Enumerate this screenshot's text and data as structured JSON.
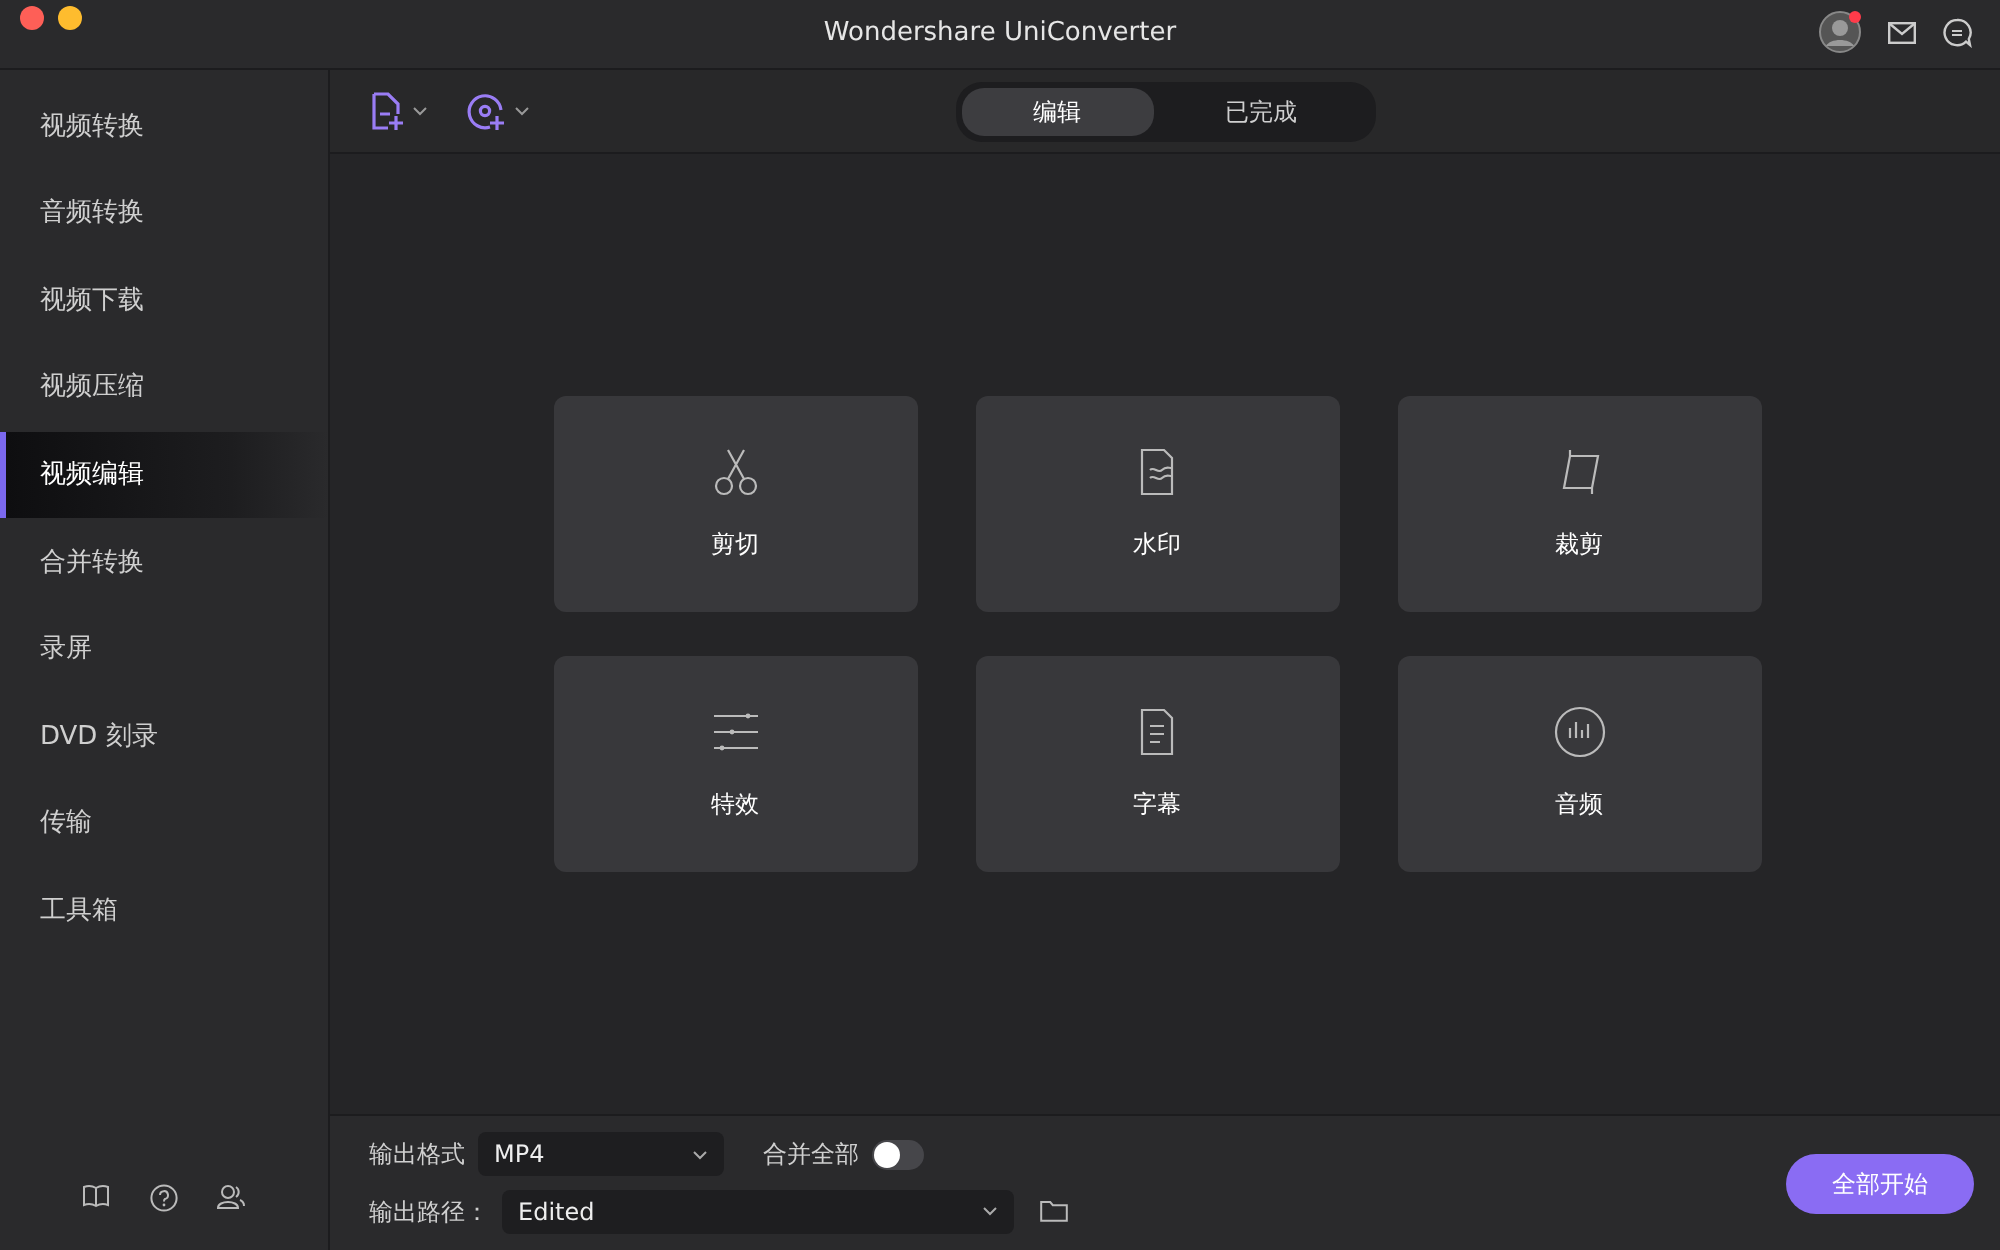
{
  "window": {
    "title": "Wondershare UniConverter"
  },
  "sidebar": {
    "items": [
      {
        "label": "视频转换",
        "selected": false
      },
      {
        "label": "音频转换",
        "selected": false
      },
      {
        "label": "视频下载",
        "selected": false
      },
      {
        "label": "视频压缩",
        "selected": false
      },
      {
        "label": "视频编辑",
        "selected": true
      },
      {
        "label": "合并转换",
        "selected": false
      },
      {
        "label": "录屏",
        "selected": false
      },
      {
        "label": "DVD 刻录",
        "selected": false
      },
      {
        "label": "传输",
        "selected": false
      },
      {
        "label": "工具箱",
        "selected": false
      }
    ]
  },
  "tabs": [
    {
      "label": "编辑",
      "selected": true
    },
    {
      "label": "已完成",
      "selected": false
    }
  ],
  "tools": [
    {
      "label": "剪切",
      "kind": "trim"
    },
    {
      "label": "水印",
      "kind": "watermark"
    },
    {
      "label": "裁剪",
      "kind": "crop"
    },
    {
      "label": "特效",
      "kind": "effects"
    },
    {
      "label": "字幕",
      "kind": "subtitle"
    },
    {
      "label": "音频",
      "kind": "audio"
    }
  ],
  "bottom_bar": {
    "format_label": "输出格式",
    "format_value": "MP4",
    "merge_label": "合并全部",
    "merge_on": false,
    "path_label": "输出路径：",
    "path_value": "Edited",
    "start_button": "全部开始"
  }
}
